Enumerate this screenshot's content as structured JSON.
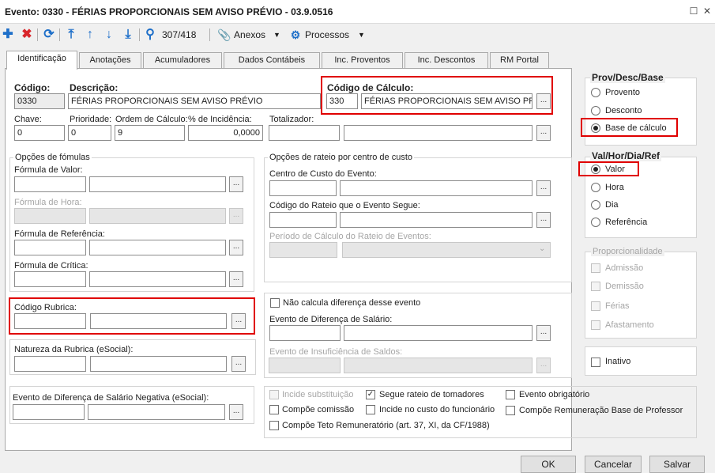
{
  "window": {
    "title": "Evento: 0330 - FÉRIAS PROPORCIONAIS SEM AVISO PRÉVIO - 03.9.0516"
  },
  "toolbar": {
    "record_counter": "307/418",
    "anexos_label": "Anexos",
    "processos_label": "Processos"
  },
  "tabs": [
    {
      "label": "Identificação"
    },
    {
      "label": "Anotações"
    },
    {
      "label": "Acumuladores"
    },
    {
      "label": "Dados Contábeis"
    },
    {
      "label": "Inc. Proventos"
    },
    {
      "label": "Inc. Descontos"
    },
    {
      "label": "RM Portal"
    }
  ],
  "ident": {
    "codigo_label": "Código:",
    "codigo_value": "0330",
    "descricao_label": "Descrição:",
    "descricao_value": "FÉRIAS PROPORCIONAIS SEM AVISO PRÉVIO",
    "codcalc_label": "Código de Cálculo:",
    "codcalc_code": "330",
    "codcalc_desc": "FÉRIAS PROPORCIONAIS SEM AVISO PR",
    "chave_label": "Chave:",
    "chave_value": "0",
    "prioridade_label": "Prioridade:",
    "prioridade_value": "0",
    "ordem_label": "Ordem de Cálculo:",
    "ordem_value": "9",
    "incidencia_label": "% de Incidência:",
    "incidencia_value": "0,0000",
    "totalizador_label": "Totalizador:"
  },
  "formulas": {
    "group_title": "Opções de fómulas",
    "valor_label": "Fórmula de Valor:",
    "hora_label": "Fórmula de Hora:",
    "referencia_label": "Fórmula de Referência:",
    "critica_label": "Fórmula de Crítica:"
  },
  "rateio": {
    "group_title": "Opções de rateio por centro de custo",
    "centro_label": "Centro de Custo do Evento:",
    "codigo_label": "Código do Rateio que o Evento Segue:",
    "periodo_label": "Período de Cálculo do Rateio de Eventos:"
  },
  "rubrica": {
    "label": "Código Rubrica:"
  },
  "natureza": {
    "label": "Natureza da Rubrica (eSocial):"
  },
  "diferenca": {
    "nao_calcula_label": "Não calcula diferença desse evento",
    "evento_dif_label": "Evento de Diferença de Salário:",
    "insuficiencia_label": "Evento de Insuficiência de Saldos:"
  },
  "dif_negativa": {
    "label": "Evento de Diferença de Salário Negativa (eSocial):"
  },
  "checks": {
    "incide_subst": "Incide substituição",
    "segue_rateio": "Segue rateio de tomadores",
    "obrigatorio": "Evento obrigatório",
    "compoe_comissao": "Compõe comissão",
    "incide_custo": "Incide no custo do funcionário",
    "compoe_remun_prof": "Compõe Remuneração Base de Professor",
    "compoe_teto": "Compõe Teto Remuneratório (art. 37, XI, da CF/1988)"
  },
  "provdesc": {
    "title": "Prov/Desc/Base",
    "provento": "Provento",
    "desconto": "Desconto",
    "base": "Base de cálculo"
  },
  "valhor": {
    "title": "Val/Hor/Dia/Ref",
    "valor": "Valor",
    "hora": "Hora",
    "dia": "Dia",
    "referencia": "Referência"
  },
  "proporcionalidade": {
    "title": "Proporcionalidade",
    "admissao": "Admissão",
    "demissao": "Demissão",
    "ferias": "Férias",
    "afastamento": "Afastamento"
  },
  "inativo": {
    "label": "Inativo"
  },
  "buttons": {
    "ok": "OK",
    "cancelar": "Cancelar",
    "salvar": "Salvar"
  }
}
